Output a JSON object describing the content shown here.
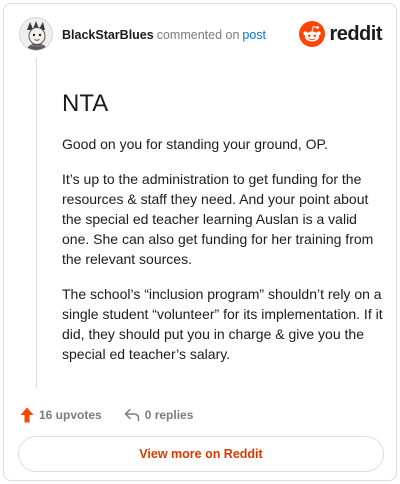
{
  "comment": {
    "author": "BlackStarBlues",
    "action_text": "commented on",
    "target_link": "post",
    "title": "NTA",
    "paragraphs": [
      "Good on you for standing your ground, OP.",
      "It’s up to the administration to get funding for the resources & staff they need. And your point about the special ed teacher learning Auslan is a valid one. She can also get funding for her training from the relevant sources.",
      "The school’s “inclusion program” shouldn’t rely on a single student “volunteer” for its implementation. If it did, they should put you in charge & give you the special ed teacher’s salary."
    ]
  },
  "brand": {
    "name": "reddit",
    "icon": "reddit-snoo-icon",
    "color": "#ff4500"
  },
  "actions": {
    "upvotes_label": "16 upvotes",
    "upvote_icon": "upvote-arrow-icon",
    "upvote_color": "#ff4500",
    "replies_label": "0 replies",
    "reply_icon": "reply-arrow-icon"
  },
  "footer": {
    "view_button_label": "View more on Reddit",
    "accent": "#d93a00"
  }
}
